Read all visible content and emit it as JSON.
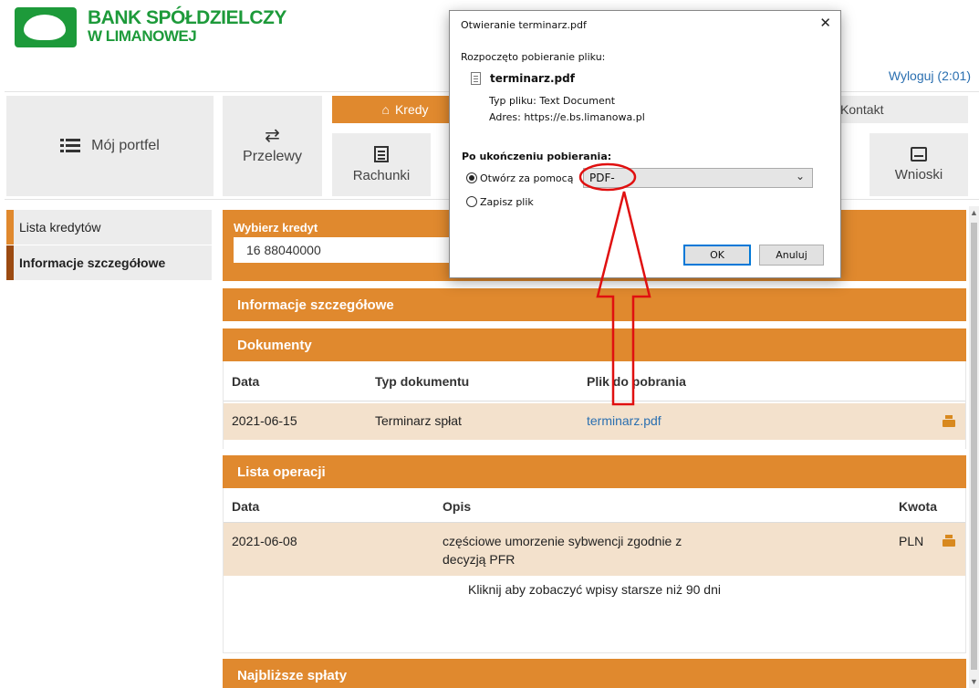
{
  "header": {
    "brand_line1": "BANK SPÓŁDZIELCZY",
    "brand_line2": "W LIMANOWEJ",
    "logout": "Wyloguj (2:01)"
  },
  "nav": {
    "portfel": "Mój portfel",
    "przelewy": "Przelewy",
    "kredyty": "Kredy",
    "rachunki": "Rachunki",
    "kontakt": "Kontakt",
    "wnioski": "Wnioski"
  },
  "sidebar": {
    "items": [
      {
        "label": "Lista kredytów"
      },
      {
        "label": "Informacje szczegółowe"
      }
    ]
  },
  "credit_picker": {
    "label": "Wybierz kredyt",
    "value": "16 88040000"
  },
  "sections": {
    "info": "Informacje szczegółowe",
    "documents": "Dokumenty",
    "operations": "Lista operacji",
    "upcoming": "Najbliższe spłaty"
  },
  "documents": {
    "headers": [
      "Data",
      "Typ dokumentu",
      "Plik do pobrania"
    ],
    "rows": [
      {
        "date": "2021-06-15",
        "type": "Terminarz spłat",
        "file": "terminarz.pdf"
      }
    ]
  },
  "operations": {
    "headers": [
      "Data",
      "Opis",
      "Kwota"
    ],
    "rows": [
      {
        "date": "2021-06-08",
        "desc_line1": "częściowe umorzenie sybwencji zgodnie z",
        "desc_line2": "decyzją PFR",
        "amount": "PLN"
      }
    ],
    "older_link": "Kliknij aby zobaczyć wpisy starsze niż 90 dni"
  },
  "dialog": {
    "title": "Otwieranie terminarz.pdf",
    "close": "✕",
    "started": "Rozpoczęto pobieranie pliku:",
    "filename": "terminarz.pdf",
    "type_label": "Typ pliku:",
    "type_value": "Text Document",
    "address_label": "Adres:",
    "address_value": "https://e.bs.limanowa.pl",
    "after_label": "Po ukończeniu pobierania:",
    "open_with": "Otwórz za pomocą",
    "open_with_value": "PDF-",
    "save_file": "Zapisz plik",
    "ok": "OK",
    "cancel": "Anuluj"
  },
  "colors": {
    "brand_green": "#1d9a3a",
    "accent_orange": "#e0892e",
    "row_highlight": "#f3e1cc",
    "link_blue": "#2a6fb0",
    "annotation_red": "#e01010"
  },
  "icons": [
    "list-icon",
    "transfer-arrows-icon",
    "home-icon",
    "document-icon",
    "inbox-tray-icon",
    "print-icon",
    "file-icon",
    "close-icon",
    "chevron-down-icon"
  ]
}
